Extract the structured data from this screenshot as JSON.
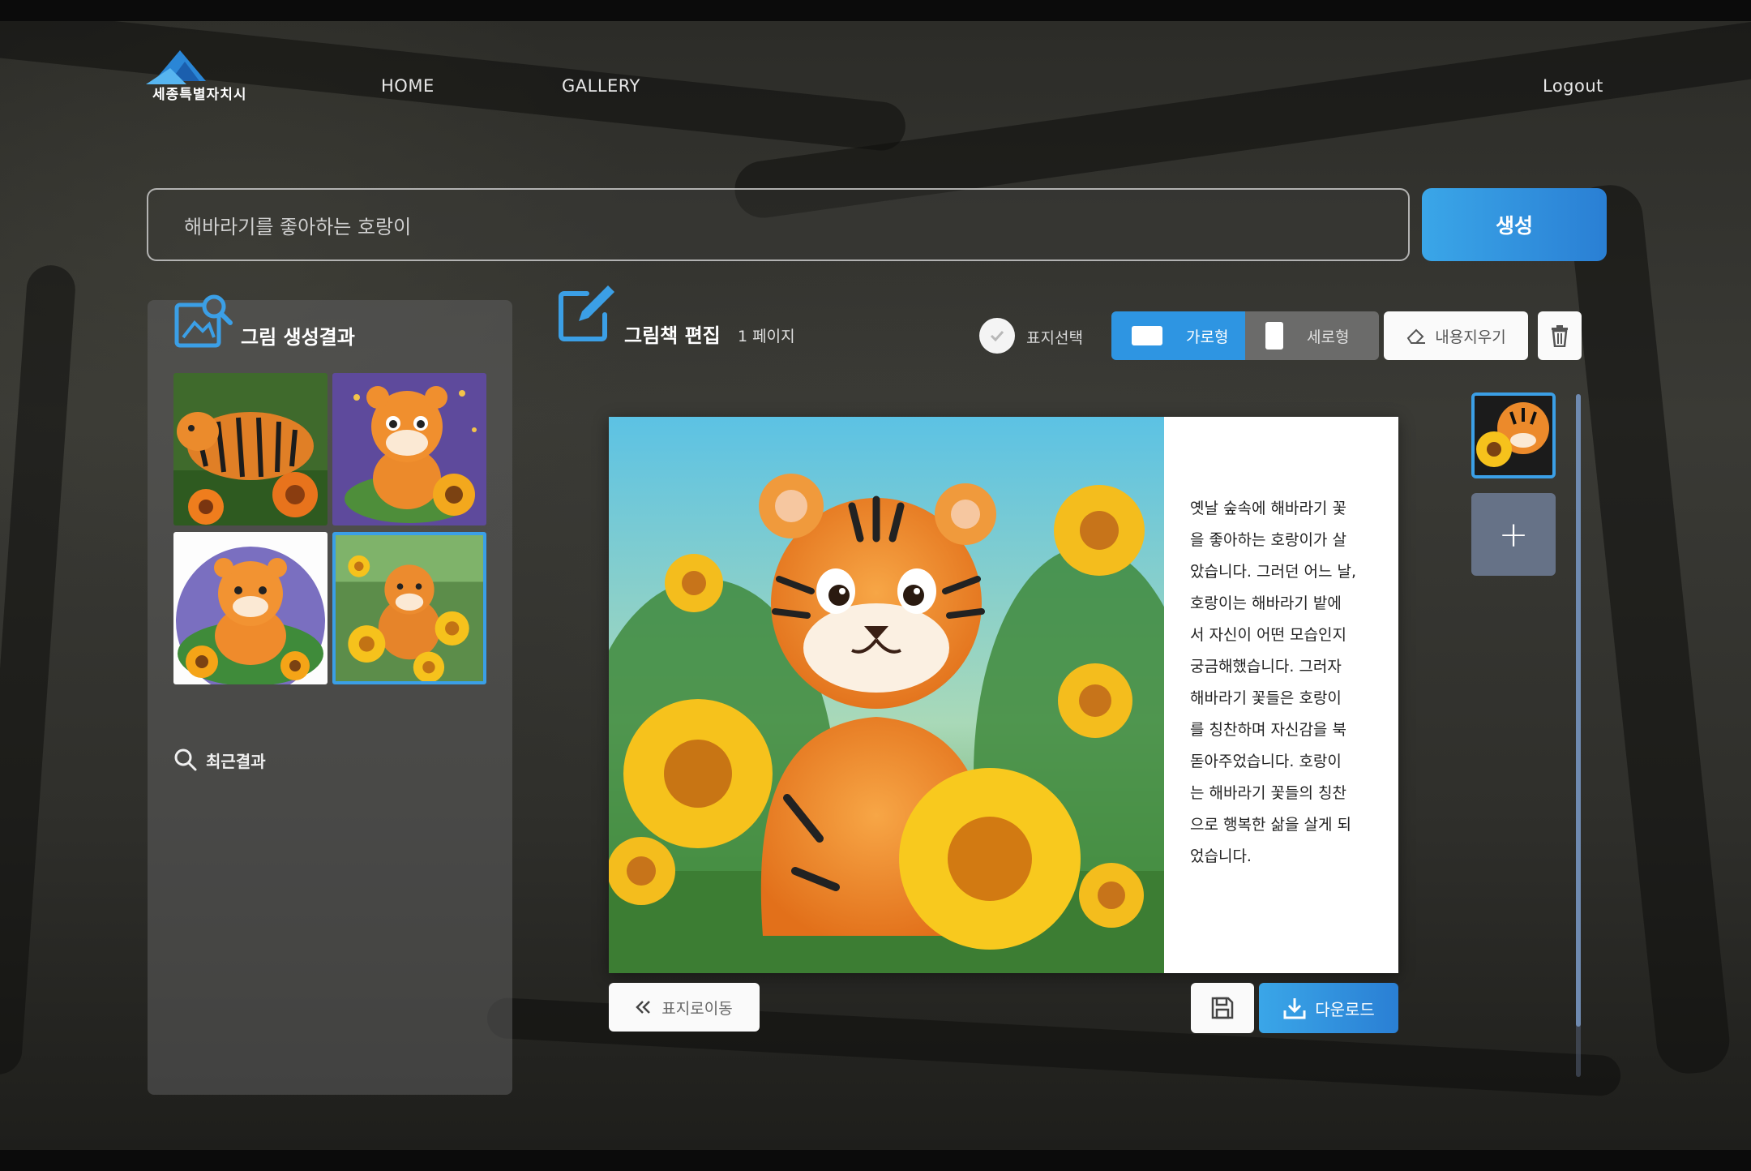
{
  "header": {
    "logo_text": "세종특별자치시",
    "nav": {
      "home": "HOME",
      "gallery": "GALLERY",
      "logout": "Logout"
    }
  },
  "search": {
    "value": "해바라기를 좋아하는 호랑이",
    "placeholder": "해바라기를 좋아하는 호랑이",
    "generate_label": "생성"
  },
  "results_panel": {
    "title": "그림 생성결과",
    "recent_label": "최근결과",
    "thumbnails": [
      "tiger-sunflower-1",
      "tiger-sunflower-2",
      "tiger-sunflower-3",
      "tiger-sunflower-4"
    ],
    "selected_index": 3
  },
  "editor": {
    "title": "그림책 편집",
    "page_label": "1 페이지",
    "cover_select_label": "표지선택",
    "orientation": {
      "horizontal": "가로형",
      "vertical": "세로형",
      "selected": "horizontal"
    },
    "clear_label": "내용지우기",
    "story_lines": [
      "옛날 숲속에 해바라기 꽃",
      "을 좋아하는 호랑이가 살",
      "았습니다. 그러던 어느 날,",
      "호랑이는 해바라기 밭에",
      "서 자신이 어떤 모습인지",
      "궁금해했습니다. 그러자",
      "해바라기 꽃들은 호랑이",
      "를 칭찬하며 자신감을 북",
      "돋아주었습니다. 호랑이",
      "는 해바라기 꽃들의 칭찬",
      "으로 행복한 삶을 살게 되",
      "었습니다."
    ],
    "back_label": "표지로이동",
    "download_label": "다운로드",
    "add_page_label": "+"
  },
  "colors": {
    "accent": "#2e95e2",
    "panel": "#5f5f5f",
    "tiger": "#f08a24",
    "sunflower": "#f6c21c"
  }
}
